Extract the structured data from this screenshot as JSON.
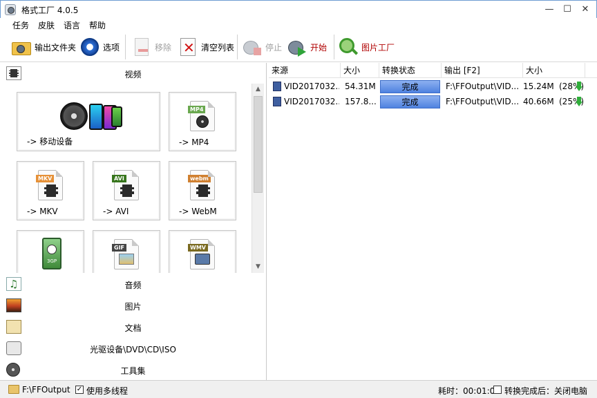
{
  "window": {
    "title": "格式工厂 4.0.5",
    "minimize": "—",
    "maximize": "☐",
    "close": "✕"
  },
  "menu": [
    "任务",
    "皮肤",
    "语言",
    "帮助"
  ],
  "toolbar": {
    "output_folder": "输出文件夹",
    "options": "选项",
    "remove": "移除",
    "clear_list": "清空列表",
    "stop": "停止",
    "start": "开始",
    "picture_factory": "图片工厂"
  },
  "left": {
    "video_header": "视频",
    "tiles": [
      {
        "label": "-> 移动设备"
      },
      {
        "label": "-> MP4",
        "tag": "MP4",
        "tag_color": "#6aa84f"
      },
      {
        "label": "-> MKV",
        "tag": "MKV",
        "tag_color": "#e69138"
      },
      {
        "label": "-> AVI",
        "tag": "AVI",
        "tag_color": "#38761d"
      },
      {
        "label": "-> WebM",
        "tag": "webm",
        "tag_color": "#d08030"
      },
      {
        "label": "",
        "tag": "3GP",
        "tag_color": "#4a8a3c"
      },
      {
        "label": "",
        "tag": "GIF",
        "tag_color": "#444444"
      },
      {
        "label": "",
        "tag": "WMV",
        "tag_color": "#7a6a20"
      }
    ],
    "categories": [
      "音频",
      "图片",
      "文档",
      "光驱设备\\DVD\\CD\\ISO",
      "工具集"
    ]
  },
  "table": {
    "headers": [
      "来源",
      "大小",
      "转换状态",
      "输出 [F2]",
      "大小"
    ],
    "rows": [
      {
        "source": "VID2017032...",
        "size": "54.31M",
        "status": "完成",
        "output": "F:\\FFOutput\\VID...",
        "out_size": "15.24M",
        "pct": "(28%)"
      },
      {
        "source": "VID2017032...",
        "size": "157.8...",
        "status": "完成",
        "output": "F:\\FFOutput\\VID...",
        "out_size": "40.66M",
        "pct": "(25%)"
      }
    ]
  },
  "status": {
    "output_path": "F:\\FFOutput",
    "multithread": "使用多线程",
    "elapsed": "耗时：00:01:05",
    "after_convert": "转换完成后：关闭电脑"
  }
}
